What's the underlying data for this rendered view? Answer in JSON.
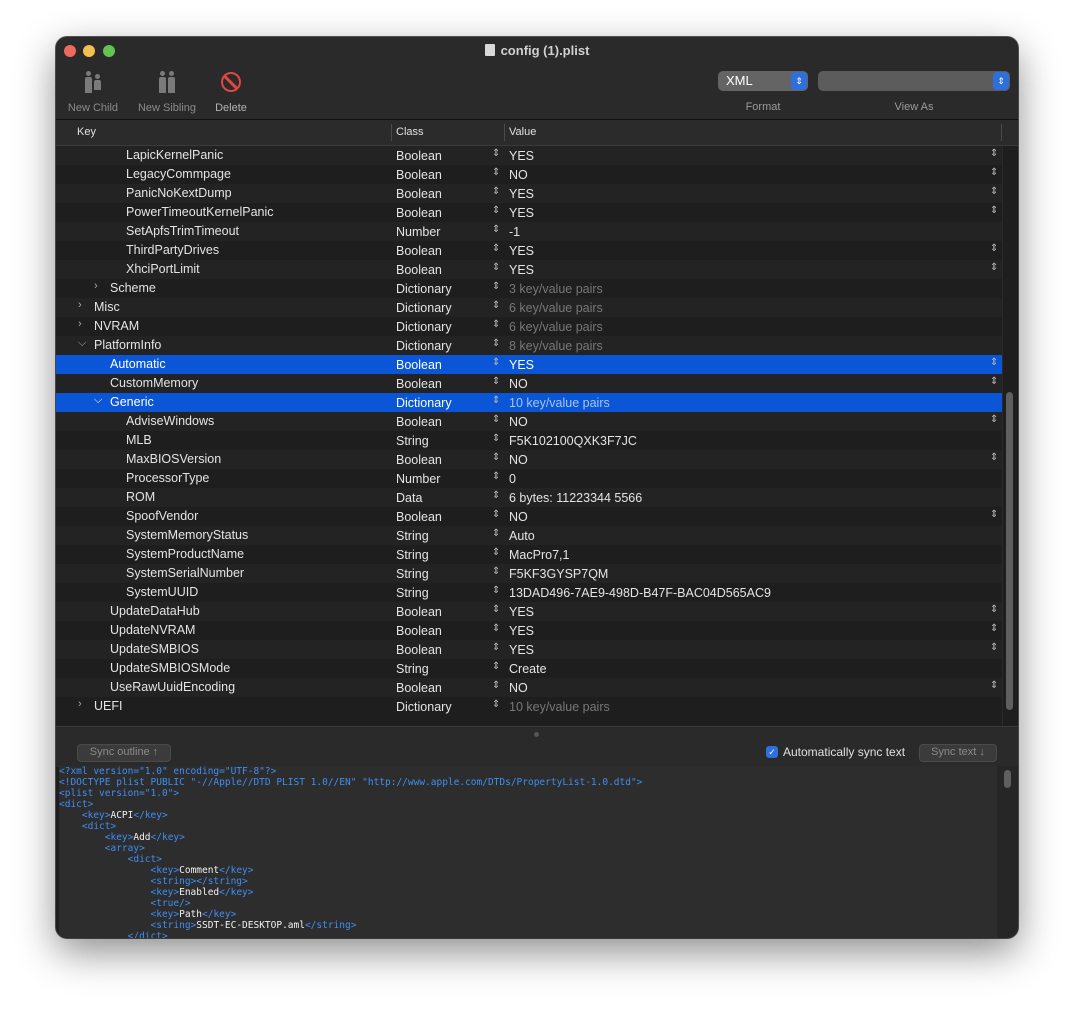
{
  "window": {
    "title": "config (1).plist"
  },
  "toolbar": {
    "new_child": "New Child",
    "new_sibling": "New Sibling",
    "delete": "Delete",
    "format_value": "XML",
    "format_label": "Format",
    "view_as_value": "",
    "view_as_label": "View As"
  },
  "columns": {
    "key": "Key",
    "class": "Class",
    "value": "Value"
  },
  "rows": [
    {
      "key": "LapicKernelPanic",
      "class": "Boolean",
      "value": "YES",
      "dd": true
    },
    {
      "key": "LegacyCommpage",
      "class": "Boolean",
      "value": "NO",
      "dd": true
    },
    {
      "key": "PanicNoKextDump",
      "class": "Boolean",
      "value": "YES",
      "dd": true
    },
    {
      "key": "PowerTimeoutKernelPanic",
      "class": "Boolean",
      "value": "YES",
      "dd": true
    },
    {
      "key": "SetApfsTrimTimeout",
      "class": "Number",
      "value": "-1"
    },
    {
      "key": "ThirdPartyDrives",
      "class": "Boolean",
      "value": "YES",
      "dd": true
    },
    {
      "key": "XhciPortLimit",
      "class": "Boolean",
      "value": "YES",
      "dd": true
    },
    {
      "key": "Scheme",
      "class": "Dictionary",
      "value": "3 key/value pairs",
      "dim": true,
      "disc": "closed"
    },
    {
      "key": "Misc",
      "class": "Dictionary",
      "value": "6 key/value pairs",
      "dim": true,
      "disc": "closed"
    },
    {
      "key": "NVRAM",
      "class": "Dictionary",
      "value": "6 key/value pairs",
      "dim": true,
      "disc": "closed"
    },
    {
      "key": "PlatformInfo",
      "class": "Dictionary",
      "value": "8 key/value pairs",
      "dim": true,
      "disc": "open"
    },
    {
      "key": "Automatic",
      "class": "Boolean",
      "value": "YES",
      "dd": true,
      "sel": true
    },
    {
      "key": "CustomMemory",
      "class": "Boolean",
      "value": "NO",
      "dd": true
    },
    {
      "key": "Generic",
      "class": "Dictionary",
      "value": "10 key/value pairs",
      "dim": true,
      "disc": "open",
      "sel": true
    },
    {
      "key": "AdviseWindows",
      "class": "Boolean",
      "value": "NO",
      "dd": true
    },
    {
      "key": "MLB",
      "class": "String",
      "value": "F5K102100QXK3F7JC"
    },
    {
      "key": "MaxBIOSVersion",
      "class": "Boolean",
      "value": "NO",
      "dd": true
    },
    {
      "key": "ProcessorType",
      "class": "Number",
      "value": "0"
    },
    {
      "key": "ROM",
      "class": "Data",
      "value": "6 bytes: 11223344 5566"
    },
    {
      "key": "SpoofVendor",
      "class": "Boolean",
      "value": "NO",
      "dd": true
    },
    {
      "key": "SystemMemoryStatus",
      "class": "String",
      "value": "Auto"
    },
    {
      "key": "SystemProductName",
      "class": "String",
      "value": "MacPro7,1"
    },
    {
      "key": "SystemSerialNumber",
      "class": "String",
      "value": "F5KF3GYSP7QM"
    },
    {
      "key": "SystemUUID",
      "class": "String",
      "value": "13DAD496-7AE9-498D-B47F-BAC04D565AC9"
    },
    {
      "key": "UpdateDataHub",
      "class": "Boolean",
      "value": "YES",
      "dd": true
    },
    {
      "key": "UpdateNVRAM",
      "class": "Boolean",
      "value": "YES",
      "dd": true
    },
    {
      "key": "UpdateSMBIOS",
      "class": "Boolean",
      "value": "YES",
      "dd": true
    },
    {
      "key": "UpdateSMBIOSMode",
      "class": "String",
      "value": "Create"
    },
    {
      "key": "UseRawUuidEncoding",
      "class": "Boolean",
      "value": "NO",
      "dd": true
    },
    {
      "key": "UEFI",
      "class": "Dictionary",
      "value": "10 key/value pairs",
      "dim": true,
      "disc": "closed"
    }
  ],
  "sync": {
    "outline_button": "Sync outline ↑",
    "auto_label": "Automatically sync text",
    "auto_checked": true,
    "text_button": "Sync text ↓"
  },
  "xml_lines": [
    [
      [
        "t",
        "<?xml version=\"1.0\" encoding=\"UTF-8\"?>"
      ]
    ],
    [
      [
        "t",
        "<!DOCTYPE plist PUBLIC \"-//Apple//DTD PLIST 1.0//EN\" \"http://www.apple.com/DTDs/PropertyList-1.0.dtd\">"
      ]
    ],
    [
      [
        "t",
        "<plist version=\"1.0\">"
      ]
    ],
    [
      [
        "t",
        "<dict>"
      ]
    ],
    [
      [
        "t",
        "    <key>"
      ],
      [
        "w",
        "ACPI"
      ],
      [
        "t",
        "</key>"
      ]
    ],
    [
      [
        "t",
        "    <dict>"
      ]
    ],
    [
      [
        "t",
        "        <key>"
      ],
      [
        "w",
        "Add"
      ],
      [
        "t",
        "</key>"
      ]
    ],
    [
      [
        "t",
        "        <array>"
      ]
    ],
    [
      [
        "t",
        "            <dict>"
      ]
    ],
    [
      [
        "t",
        "                <key>"
      ],
      [
        "w",
        "Comment"
      ],
      [
        "t",
        "</key>"
      ]
    ],
    [
      [
        "t",
        "                <string></string>"
      ]
    ],
    [
      [
        "t",
        "                <key>"
      ],
      [
        "w",
        "Enabled"
      ],
      [
        "t",
        "</key>"
      ]
    ],
    [
      [
        "t",
        "                <true/>"
      ]
    ],
    [
      [
        "t",
        "                <key>"
      ],
      [
        "w",
        "Path"
      ],
      [
        "t",
        "</key>"
      ]
    ],
    [
      [
        "t",
        "                <string>"
      ],
      [
        "w",
        "SSDT-EC-DESKTOP.aml"
      ],
      [
        "t",
        "</string>"
      ]
    ],
    [
      [
        "t",
        "            </dict>"
      ]
    ]
  ],
  "colors": {
    "selection": "#0a56d6",
    "accent": "#2f6fdb",
    "xml_tag": "#3f8ef2",
    "delete": "#e04642"
  }
}
